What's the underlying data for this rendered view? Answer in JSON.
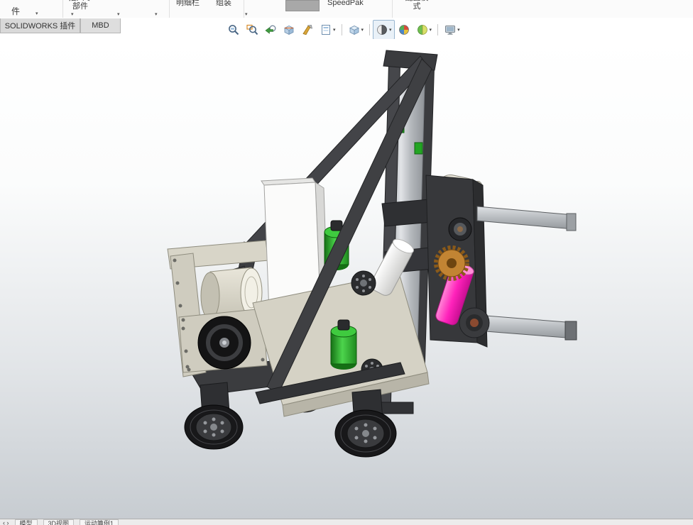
{
  "ribbon": {
    "items": [
      {
        "label": "件"
      },
      {
        "label": "插入零部件"
      },
      {
        "label": "明细栏"
      },
      {
        "label": "组装"
      },
      {
        "label": "SpeedPak"
      },
      {
        "label": "配置模式"
      }
    ],
    "dropdown_glyph": "▾"
  },
  "command_tabs": [
    {
      "label": "SOLIDWORKS 插件"
    },
    {
      "label": "MBD"
    }
  ],
  "headsup_toolbar": {
    "dropdown_glyph": "▾",
    "icons": [
      "zoom-to-fit",
      "zoom-to-area",
      "previous-view",
      "section-view",
      "dynamic-annotation",
      "hide-show-items",
      "view-orientation",
      "display-style",
      "edit-appearance",
      "apply-scene",
      "view-settings"
    ]
  },
  "viewport_colors": {
    "frame": "#3f4043",
    "panel_beige": "#d5d2c5",
    "motor_green": "#2fae2f",
    "roller_pink": "#ff22bb",
    "roller_white": "#f4f4f2",
    "metal": "#b7bbbf",
    "wheel": "#18181a",
    "sprocket_bronze": "#c28433",
    "background_top": "#ffffff",
    "background_bottom": "#c7ccd1"
  },
  "statusbar": {
    "nav_glyphs": "‹ ›",
    "tabs": [
      "模型",
      "3D视图",
      "运动算例1"
    ]
  }
}
